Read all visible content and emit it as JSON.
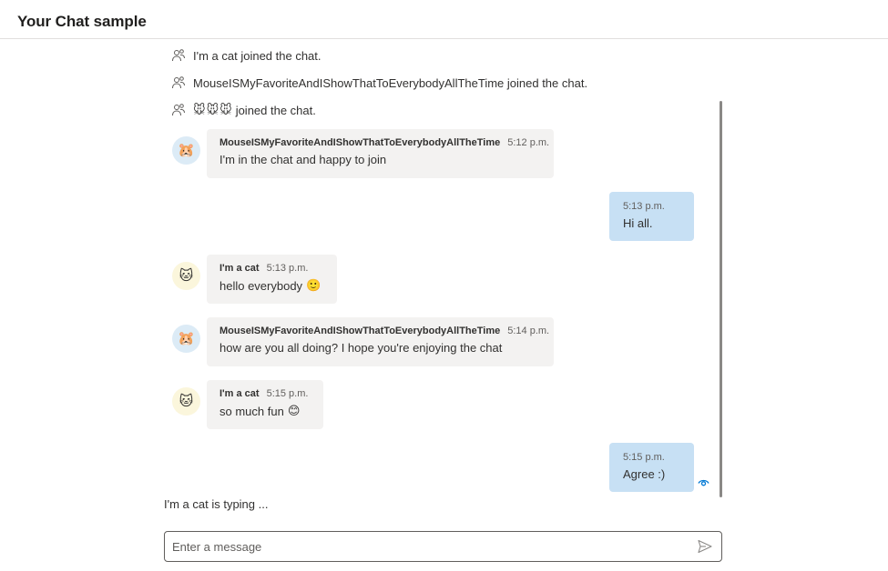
{
  "app": {
    "title": "Your Chat sample"
  },
  "system_messages": [
    {
      "text": "I'm a cat joined the chat."
    },
    {
      "text": "MouseISMyFavoriteAndIShowThatToEverybodyAllTheTime joined the chat."
    },
    {
      "emojis": [
        "🐭",
        "🐭",
        "🐭"
      ],
      "text": "joined the chat."
    }
  ],
  "messages": [
    {
      "type": "other",
      "avatar": "🐹",
      "sender": "MouseISMyFavoriteAndIShowThatToEverybodyAllTheTime",
      "time": "5:12 p.m.",
      "text": "I'm in the chat and happy to join"
    },
    {
      "type": "mine",
      "time": "5:13 p.m.",
      "text": "Hi all."
    },
    {
      "type": "other",
      "avatar": "🐱",
      "sender": "I'm a cat",
      "time": "5:13 p.m.",
      "text": "hello everybody",
      "emoji": "🙂"
    },
    {
      "type": "other",
      "avatar": "🐹",
      "sender": "MouseISMyFavoriteAndIShowThatToEverybodyAllTheTime",
      "time": "5:14 p.m.",
      "text": "how are you all doing? I hope you're enjoying the chat"
    },
    {
      "type": "other",
      "avatar": "🐱",
      "sender": "I'm a cat",
      "time": "5:15 p.m.",
      "text": "so much fun",
      "emoji": "😊"
    },
    {
      "type": "mine",
      "time": "5:15 p.m.",
      "text": "Agree :)",
      "status_icon": "seen-eye-icon"
    }
  ],
  "typing_indicator": "I'm a cat is typing ...",
  "composer": {
    "placeholder": "Enter a message",
    "value": ""
  },
  "icons": {
    "join": "participant-add-icon",
    "send": "send-icon",
    "seen": "seen-eye-icon"
  },
  "colors": {
    "own_bubble": "#c7e0f4",
    "other_bubble": "#f3f2f1",
    "accent": "#0078d4"
  }
}
